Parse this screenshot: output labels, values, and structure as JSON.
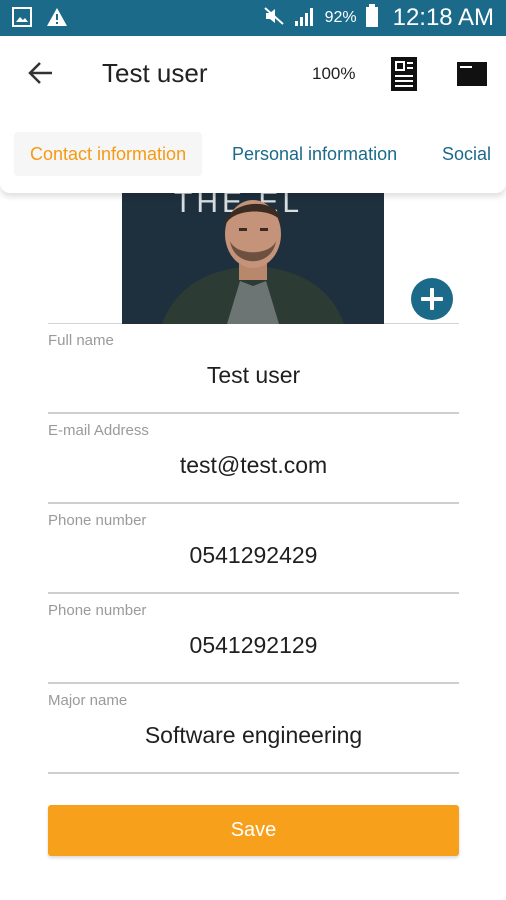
{
  "status_bar": {
    "battery_percent": "92%",
    "time": "12:18 AM",
    "icons": [
      "image-icon",
      "warning-icon",
      "mute-icon",
      "signal-icon",
      "battery-icon"
    ]
  },
  "header": {
    "title": "Test user",
    "zoom": "100%",
    "icons": [
      "back-arrow-icon",
      "document-icon",
      "card-icon"
    ]
  },
  "tabs": [
    {
      "label": "Contact information",
      "active": true
    },
    {
      "label": "Personal information",
      "active": false
    },
    {
      "label": "Social",
      "active": false
    }
  ],
  "photo": {
    "overlay_text": "THE   EL"
  },
  "form": {
    "fields": [
      {
        "label": "Full name",
        "value": "Test user"
      },
      {
        "label": "E-mail Address",
        "value": "test@test.com"
      },
      {
        "label": "Phone number",
        "value": "0541292429"
      },
      {
        "label": "Phone number",
        "value": "0541292129"
      },
      {
        "label": "Major name",
        "value": "Software engineering"
      }
    ]
  },
  "save_label": "Save",
  "colors": {
    "status_bar": "#1b6a8a",
    "accent_orange": "#f7a01b",
    "tab_blue": "#1b6a8a",
    "add_button": "#1b6a8a"
  }
}
